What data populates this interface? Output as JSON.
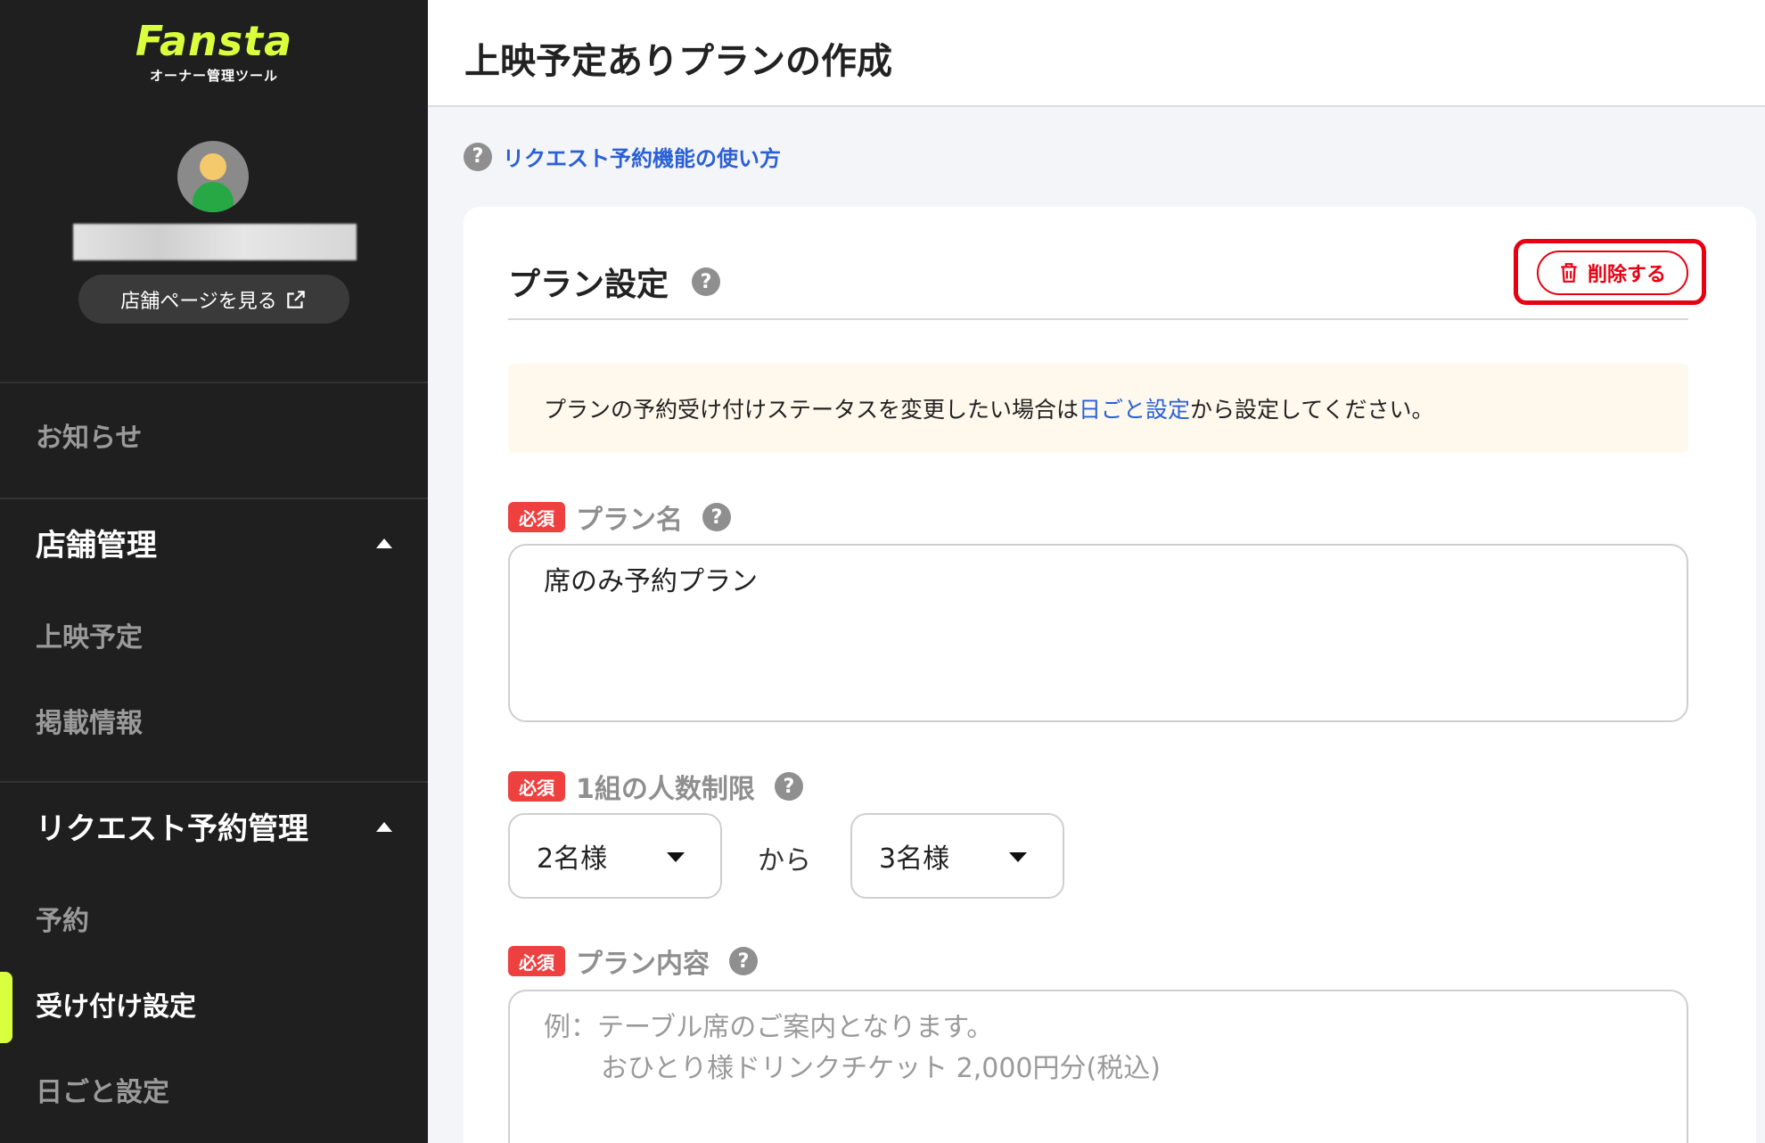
{
  "sidebar": {
    "logo": "Fansta",
    "logo_sub": "オーナー管理ツール",
    "store_page_button": "店舗ページを見る",
    "items": {
      "news": "お知らせ",
      "store_management": "店舗管理",
      "screening_schedule": "上映予定",
      "listing_info": "掲載情報",
      "request_reservation_management": "リクエスト予約管理",
      "reservations": "予約",
      "acceptance_settings": "受け付け設定",
      "daily_settings": "日ごと設定"
    }
  },
  "header": {
    "title": "上映予定ありプランの作成"
  },
  "help_link": {
    "icon": "?",
    "label": "リクエスト予約機能の使い方"
  },
  "card": {
    "title": "プラン設定",
    "help_icon": "?",
    "delete_button": "削除する",
    "notice": {
      "prefix": "プランの予約受け付けステータスを変更したい場合は",
      "link": "日ごと設定",
      "suffix": "から設定してください。"
    },
    "fields": {
      "required_badge": "必須",
      "plan_name": {
        "label": "プラン名",
        "value": "席のみ予約プラン"
      },
      "party_size": {
        "label": "1組の人数制限",
        "min": "2名様",
        "between": "から",
        "max": "3名様"
      },
      "plan_content": {
        "label": "プラン内容",
        "placeholder_line1": "例：テーブル席のご案内となります。",
        "placeholder_line2": "おひとり様ドリンクチケット 2,000円分(税込)"
      }
    }
  },
  "colors": {
    "brand_lime": "#d9ff3d",
    "danger_red": "#e60012",
    "link_blue": "#2a5fd6"
  }
}
